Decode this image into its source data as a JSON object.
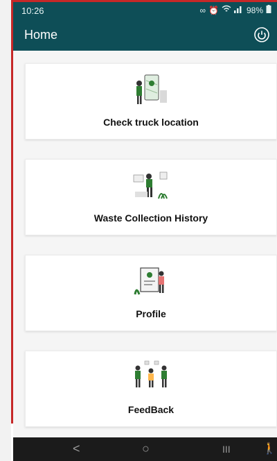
{
  "status": {
    "time": "10:26",
    "battery": "98%"
  },
  "appbar": {
    "title": "Home"
  },
  "cards": [
    {
      "label": "Check truck location",
      "icon": "map-location-illustration"
    },
    {
      "label": "Waste Collection History",
      "icon": "history-illustration"
    },
    {
      "label": "Profile",
      "icon": "profile-illustration"
    },
    {
      "label": "FeedBack",
      "icon": "feedback-illustration"
    }
  ],
  "nav": {
    "back": "<",
    "home": "○",
    "recents": "III",
    "accessibility": "🚶"
  },
  "colors": {
    "primary": "#0e4e57",
    "frame": "#c62828",
    "accent_green": "#2e7d32"
  }
}
